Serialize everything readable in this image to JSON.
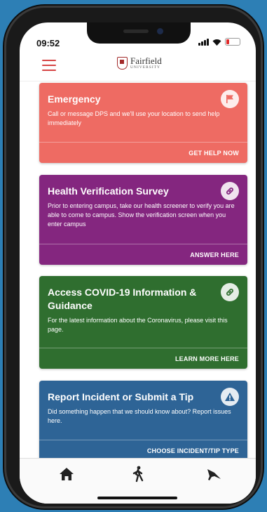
{
  "status_bar": {
    "time": "09:52"
  },
  "header": {
    "logo_name": "Fairfield",
    "logo_sub": "UNIVERSITY"
  },
  "cards": [
    {
      "title": "Emergency",
      "description": "Call or message DPS and we'll use your location to send help immediately",
      "action": "GET HELP NOW",
      "color": "#ee6b63",
      "icon": "flag-icon"
    },
    {
      "title": "Health Verification Survey",
      "description": "Prior to entering campus, take our health screener to verify you are able to come to campus.  Show the verification screen when you enter campus",
      "action": "ANSWER HERE",
      "color": "#84267f",
      "icon": "link-icon"
    },
    {
      "title": "Access COVID-19 Information & Guidance",
      "description": "For the latest information about the Coronavirus, please visit this page.",
      "action": "LEARN MORE HERE",
      "color": "#2f6e2f",
      "icon": "link-icon"
    },
    {
      "title": "Report Incident or Submit a Tip",
      "description": "Did something happen that we should know about? Report issues here.",
      "action": "CHOOSE INCIDENT/TIP TYPE",
      "color": "#2e6496",
      "icon": "warning-icon"
    }
  ],
  "tabs": [
    {
      "icon": "home-icon"
    },
    {
      "icon": "walking-person-icon"
    },
    {
      "icon": "megaphone-icon"
    }
  ],
  "colors": {
    "accent": "#d64545",
    "background": "#2d7fb5"
  }
}
